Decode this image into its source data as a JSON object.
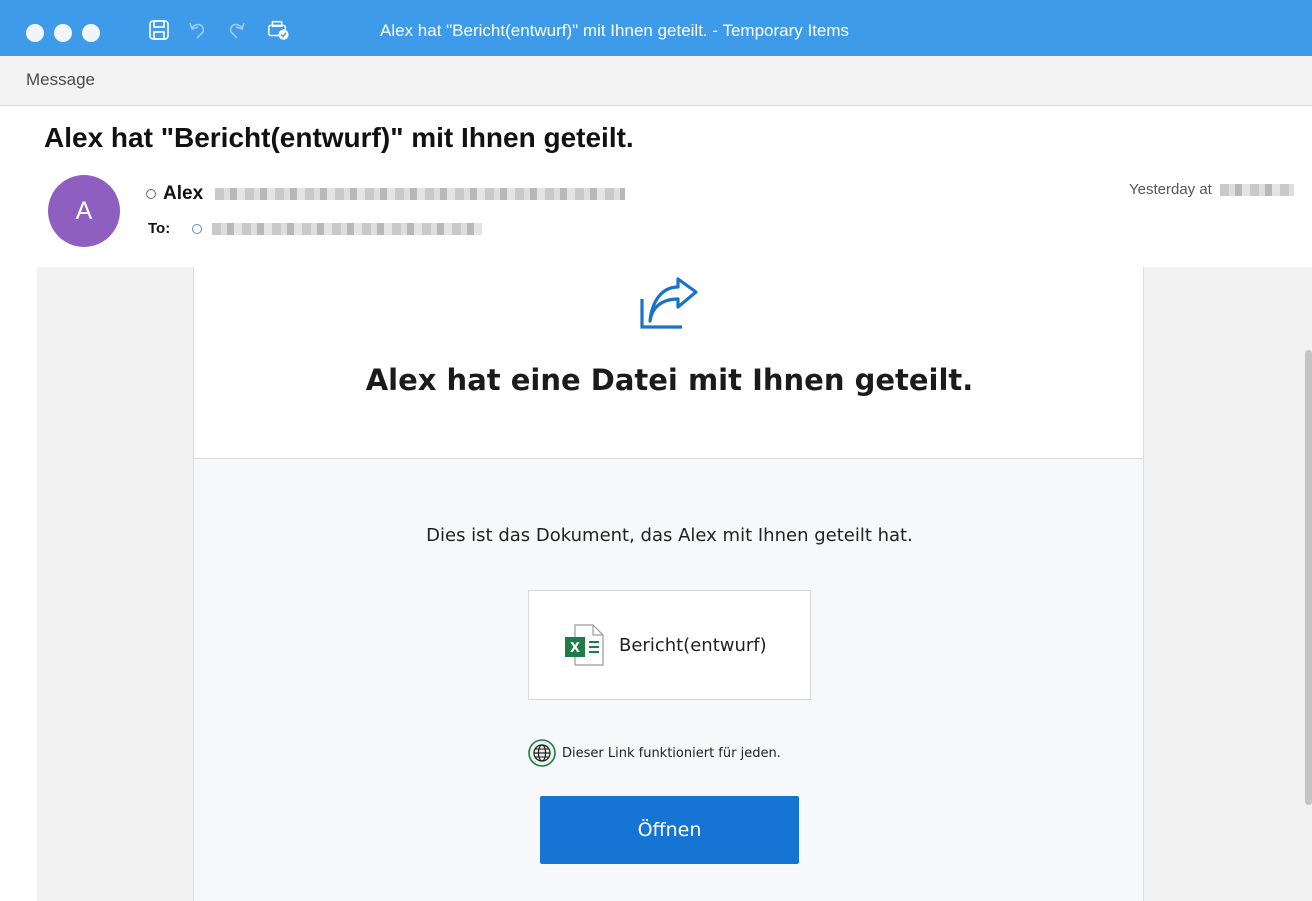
{
  "window": {
    "title": "Alex hat \"Bericht(entwurf)\" mit Ihnen geteilt. - Temporary Items",
    "titlebar_color": "#3d9be9"
  },
  "ribbon": {
    "tab": "Message"
  },
  "message": {
    "subject": "Alex hat \"Bericht(entwurf)\" mit Ihnen geteilt.",
    "avatar_initial": "A",
    "avatar_color": "#8e5fc0",
    "from_name": "Alex",
    "to_label": "To:",
    "date_label": "Yesterday at"
  },
  "content": {
    "heading": "Alex hat eine Datei mit Ihnen geteilt.",
    "description": "Dies ist das Dokument, das Alex mit Ihnen geteilt hat.",
    "file_name": "Bericht(entwurf)",
    "link_note": "Dieser Link funktioniert für jeden.",
    "open_button": "Öffnen",
    "button_color": "#1675d4",
    "excel_icon": "excel-file-icon",
    "share_icon": "share-arrow-icon",
    "globe_icon": "globe-icon"
  }
}
